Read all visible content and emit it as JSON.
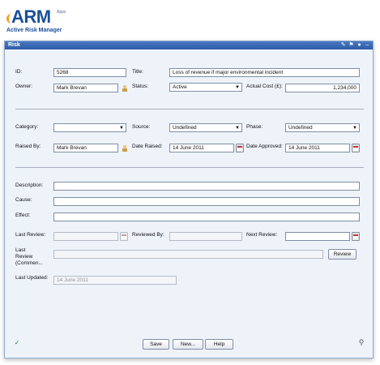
{
  "app": {
    "brand": "ARM",
    "apps_label": "Apps",
    "subtitle": "Active Risk Manager"
  },
  "window": {
    "title": "Risk"
  },
  "fields": {
    "id": {
      "label": "ID:",
      "value": "5268"
    },
    "title": {
      "label": "Title:",
      "value": "Loss of revenue if major environmental incident"
    },
    "owner": {
      "label": "Owner:",
      "value": "Mark Brevan"
    },
    "status": {
      "label": "Status:",
      "value": "Active"
    },
    "actual_cost": {
      "label": "Actual Cost (£):",
      "value": "1,234,000"
    },
    "category": {
      "label": "Category:",
      "value": ""
    },
    "source": {
      "label": "Source:",
      "value": "Undefined"
    },
    "phase": {
      "label": "Phase:",
      "value": "Undefined"
    },
    "raised_by": {
      "label": "Raised By:",
      "value": "Mark Brevan"
    },
    "date_raised": {
      "label": "Date Raised:",
      "value": "14 June 2011"
    },
    "date_approved": {
      "label": "Date Approved:",
      "value": "14 June 2011"
    },
    "description": {
      "label": "Description:",
      "value": ""
    },
    "cause": {
      "label": "Cause:",
      "value": ""
    },
    "effect": {
      "label": "Effect:",
      "value": ""
    },
    "last_review": {
      "label": "Last Review:",
      "value": ""
    },
    "reviewed_by": {
      "label": "Reviewed By:",
      "value": ""
    },
    "next_review": {
      "label": "Next Review:",
      "value": ""
    },
    "last_review_comments": {
      "label_line1": "Last",
      "label_line2": "Review",
      "label_line3": "(Commen...",
      "value": ""
    },
    "last_updated": {
      "label": "Last Updated:",
      "value": "14 June 2011"
    }
  },
  "buttons": {
    "review": "Review",
    "save": "Save",
    "new": "New...",
    "help": "Help"
  },
  "icons": {
    "window_controls": [
      "pin-icon",
      "flag-icon",
      "lock-icon",
      "minimize-icon"
    ],
    "person": "person-picker-icon",
    "calendar": "calendar-icon",
    "spellcheck": "spellcheck-icon",
    "attachment": "paperclip-icon"
  },
  "colors": {
    "titlebar": "#2d5aa6",
    "brand": "#1b4f9c",
    "accent": "#f2a11f",
    "panel": "#eef3fa"
  }
}
